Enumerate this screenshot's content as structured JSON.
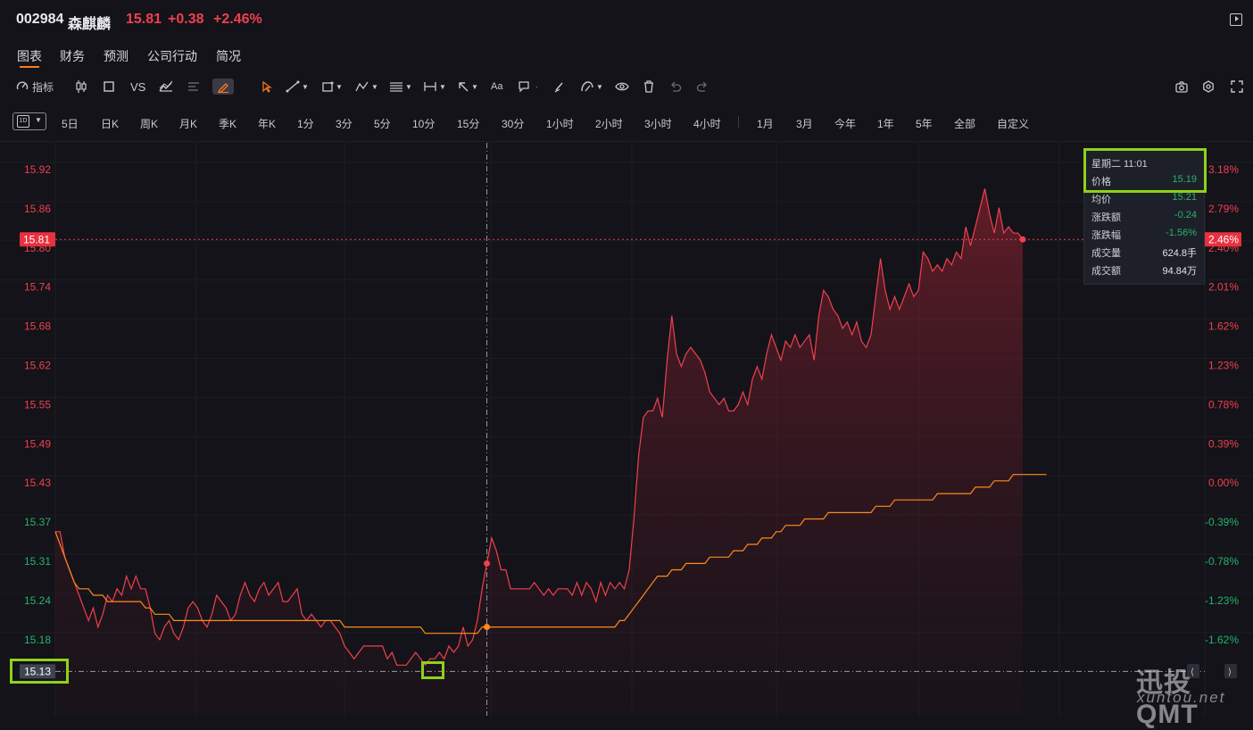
{
  "header": {
    "code": "002984",
    "name": "森麒麟",
    "price": "15.81",
    "change": "+0.38",
    "change_pct": "+2.46%"
  },
  "tabs": [
    "图表",
    "财务",
    "预测",
    "公司行动",
    "简况"
  ],
  "toolbar": {
    "indicator_label": "指标",
    "vs_label": "VS",
    "text_tool_label": "Aa"
  },
  "period_selector": {
    "icon": "1D"
  },
  "periods": [
    "5日",
    "日K",
    "周K",
    "月K",
    "季K",
    "年K",
    "1分",
    "3分",
    "5分",
    "10分",
    "15分",
    "30分",
    "1小时",
    "2小时",
    "3小时",
    "4小时"
  ],
  "ranges": [
    "1月",
    "3月",
    "今年",
    "1年",
    "5年",
    "全部",
    "自定义"
  ],
  "tooltip": {
    "datetime": "星期二 11:01",
    "rows": [
      {
        "label": "价格",
        "value": "15.19"
      },
      {
        "label": "均价",
        "value": "15.21"
      },
      {
        "label": "涨跌额",
        "value": "-0.24"
      },
      {
        "label": "涨跌幅",
        "value": "-1.56%"
      },
      {
        "label": "成交量",
        "value": "624.8手"
      },
      {
        "label": "成交额",
        "value": "94.84万"
      }
    ]
  },
  "chart_data": {
    "type": "line",
    "prev_close": 15.43,
    "ylim": [
      15.1,
      15.97
    ],
    "price_ticks": [
      "15.92",
      "15.86",
      "15.80",
      "15.74",
      "15.68",
      "15.62",
      "15.55",
      "15.49",
      "15.43",
      "15.37",
      "15.31",
      "15.24",
      "15.18"
    ],
    "pct_ticks": [
      "3.18%",
      "2.79%",
      "2.40%",
      "2.01%",
      "1.62%",
      "1.23%",
      "0.78%",
      "0.39%",
      "0.00%",
      "-0.39%",
      "-0.78%",
      "-1.23%",
      "-1.62%"
    ],
    "current_price_label": "15.81",
    "current_pct_label": "2.46%",
    "crosshair_price_label": "15.13",
    "series": [
      {
        "values": [
          15.35,
          15.35,
          15.31,
          15.29,
          15.27,
          15.25,
          15.23,
          15.21,
          15.23,
          15.2,
          15.22,
          15.25,
          15.24,
          15.26,
          15.25,
          15.28,
          15.26,
          15.28,
          15.26,
          15.26,
          15.23,
          15.19,
          15.18,
          15.2,
          15.21,
          15.19,
          15.18,
          15.2,
          15.23,
          15.24,
          15.23,
          15.21,
          15.2,
          15.22,
          15.25,
          15.24,
          15.23,
          15.21,
          15.22,
          15.25,
          15.27,
          15.25,
          15.24,
          15.26,
          15.27,
          15.25,
          15.26,
          15.27,
          15.24,
          15.24,
          15.25,
          15.26,
          15.22,
          15.21,
          15.22,
          15.21,
          15.2,
          15.21,
          15.21,
          15.2,
          15.19,
          15.17,
          15.16,
          15.15,
          15.16,
          15.17,
          15.17,
          15.17,
          15.17,
          15.17,
          15.15,
          15.16,
          15.14,
          15.14,
          15.14,
          15.15,
          15.16,
          15.15,
          15.14,
          15.15,
          15.15,
          15.16,
          15.15,
          15.17,
          15.16,
          15.17,
          15.2,
          15.17,
          15.18,
          15.21,
          15.26,
          15.3,
          15.34,
          15.32,
          15.29,
          15.29,
          15.26,
          15.26,
          15.26,
          15.26,
          15.26,
          15.27,
          15.26,
          15.25,
          15.26,
          15.25,
          15.26,
          15.26,
          15.26,
          15.25,
          15.27,
          15.25,
          15.27,
          15.26,
          15.24,
          15.27,
          15.25,
          15.27,
          15.26,
          15.27,
          15.26,
          15.29,
          15.37,
          15.47,
          15.53,
          15.54,
          15.54,
          15.56,
          15.53,
          15.62,
          15.69,
          15.63,
          15.61,
          15.63,
          15.64,
          15.63,
          15.62,
          15.6,
          15.57,
          15.56,
          15.55,
          15.56,
          15.54,
          15.54,
          15.55,
          15.57,
          15.55,
          15.59,
          15.61,
          15.59,
          15.63,
          15.66,
          15.64,
          15.62,
          15.65,
          15.64,
          15.66,
          15.64,
          15.65,
          15.66,
          15.62,
          15.69,
          15.73,
          15.72,
          15.7,
          15.69,
          15.67,
          15.68,
          15.66,
          15.68,
          15.65,
          15.64,
          15.66,
          15.72,
          15.78,
          15.73,
          15.7,
          15.72,
          15.7,
          15.72,
          15.74,
          15.72,
          15.73,
          15.79,
          15.78,
          15.76,
          15.77,
          15.76,
          15.78,
          15.77,
          15.79,
          15.78,
          15.83,
          15.8,
          15.83,
          15.86,
          15.89,
          15.85,
          15.82,
          15.86,
          15.82,
          15.83,
          15.82,
          15.82,
          15.81
        ]
      },
      {
        "values": [
          15.35,
          15.33,
          15.31,
          15.29,
          15.27,
          15.26,
          15.26,
          15.26,
          15.25,
          15.25,
          15.25,
          15.24,
          15.24,
          15.24,
          15.24,
          15.24,
          15.24,
          15.24,
          15.24,
          15.23,
          15.23,
          15.22,
          15.22,
          15.22,
          15.22,
          15.21,
          15.21,
          15.21,
          15.21,
          15.21,
          15.21,
          15.21,
          15.21,
          15.21,
          15.21,
          15.21,
          15.21,
          15.21,
          15.21,
          15.21,
          15.21,
          15.21,
          15.21,
          15.21,
          15.21,
          15.21,
          15.21,
          15.21,
          15.21,
          15.21,
          15.21,
          15.21,
          15.21,
          15.21,
          15.21,
          15.21,
          15.21,
          15.21,
          15.21,
          15.21,
          15.21,
          15.2,
          15.2,
          15.2,
          15.2,
          15.2,
          15.2,
          15.2,
          15.2,
          15.2,
          15.2,
          15.2,
          15.2,
          15.2,
          15.2,
          15.2,
          15.2,
          15.2,
          15.19,
          15.19,
          15.19,
          15.19,
          15.19,
          15.19,
          15.19,
          15.19,
          15.19,
          15.19,
          15.19,
          15.19,
          15.2,
          15.2,
          15.2,
          15.2,
          15.2,
          15.2,
          15.2,
          15.2,
          15.2,
          15.2,
          15.2,
          15.2,
          15.2,
          15.2,
          15.2,
          15.2,
          15.2,
          15.2,
          15.2,
          15.2,
          15.2,
          15.2,
          15.2,
          15.2,
          15.2,
          15.2,
          15.2,
          15.2,
          15.2,
          15.21,
          15.21,
          15.22,
          15.23,
          15.24,
          15.25,
          15.26,
          15.27,
          15.28,
          15.28,
          15.28,
          15.29,
          15.29,
          15.29,
          15.3,
          15.3,
          15.3,
          15.3,
          15.3,
          15.31,
          15.31,
          15.31,
          15.31,
          15.31,
          15.32,
          15.32,
          15.32,
          15.33,
          15.33,
          15.33,
          15.34,
          15.34,
          15.34,
          15.35,
          15.35,
          15.36,
          15.36,
          15.36,
          15.36,
          15.37,
          15.37,
          15.37,
          15.37,
          15.37,
          15.38,
          15.38,
          15.38,
          15.38,
          15.38,
          15.38,
          15.38,
          15.38,
          15.38,
          15.38,
          15.39,
          15.39,
          15.39,
          15.39,
          15.4,
          15.4,
          15.4,
          15.4,
          15.4,
          15.4,
          15.4,
          15.4,
          15.4,
          15.41,
          15.41,
          15.41,
          15.41,
          15.41,
          15.41,
          15.41,
          15.41,
          15.42,
          15.42,
          15.42,
          15.42,
          15.43,
          15.43,
          15.43,
          15.43,
          15.44,
          15.44,
          15.44,
          15.44,
          15.44,
          15.44,
          15.44,
          15.44
        ]
      }
    ],
    "crosshair_index": 91,
    "grid": true
  },
  "watermark": {
    "main": "迅投QMT",
    "sub": "xuntou.net"
  },
  "colors": {
    "up": "#f0404d",
    "down": "#26b36b",
    "avg_line": "#ff8a1a",
    "accent": "#ff7a1a",
    "highlight": "#8fd11a"
  }
}
